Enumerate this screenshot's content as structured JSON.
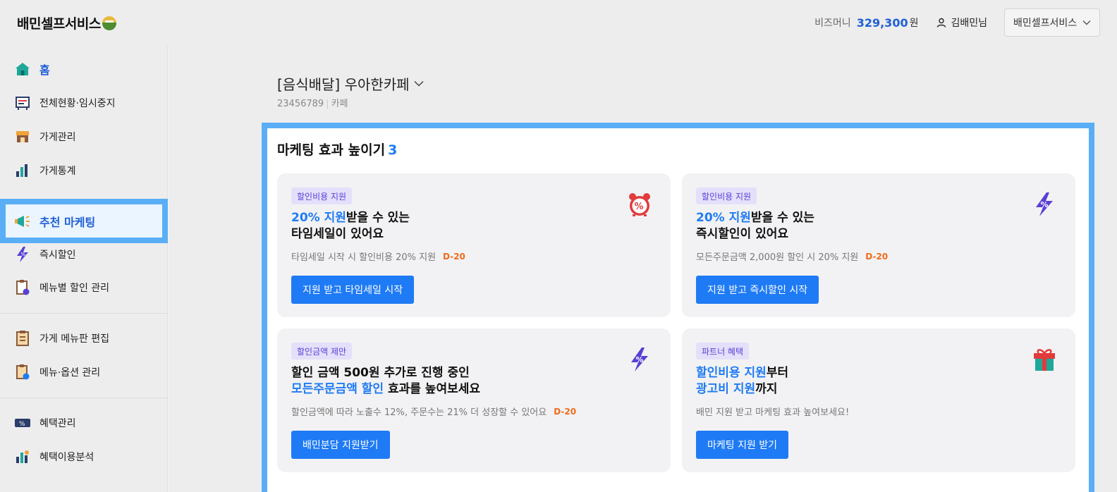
{
  "header": {
    "logo": "배민셀프서비스",
    "bizmoney_label": "비즈머니",
    "bizmoney_amount": "329,300",
    "bizmoney_unit": "원",
    "user_name": "김배민님",
    "store_select": "배민셀프서비스"
  },
  "sidebar": {
    "items": [
      {
        "label": "홈",
        "icon": "home-icon"
      },
      {
        "label": "전체현황·임시중지",
        "icon": "board-icon"
      },
      {
        "label": "가게관리",
        "icon": "store-icon"
      },
      {
        "label": "가게통계",
        "icon": "bar-chart-icon"
      },
      {
        "label": "추천 마케팅",
        "icon": "megaphone-icon"
      },
      {
        "label": "즉시할인",
        "icon": "lightning-percent-icon"
      },
      {
        "label": "메뉴별 할인 관리",
        "icon": "menu-discount-icon"
      },
      {
        "label": "가게 메뉴판 편집",
        "icon": "menu-board-icon"
      },
      {
        "label": "메뉴·옵션 관리",
        "icon": "menu-option-icon"
      },
      {
        "label": "혜택관리",
        "icon": "coupon-icon"
      },
      {
        "label": "혜택이용분석",
        "icon": "analysis-icon"
      }
    ]
  },
  "main": {
    "shop_title": "[음식배달] 우아한카페",
    "shop_id": "23456789",
    "shop_category": "카페",
    "panel_title": "마케팅 효과 높이기",
    "panel_count": "3",
    "cards": [
      {
        "badge": "할인비용 지원",
        "line1_highlight": "20% 지원",
        "line1_rest": "받을 수 있는",
        "line2_highlight": "",
        "line2_rest": "타임세일이 있어요",
        "desc": "타임세일 시작 시 할인비용 20% 지원",
        "dday": "D-20",
        "cta": "지원 받고 타임세일 시작",
        "icon": "alarm-clock-percent-icon"
      },
      {
        "badge": "할인비용 지원",
        "line1_highlight": "20% 지원",
        "line1_rest": "받을 수 있는",
        "line2_highlight": "",
        "line2_rest": "즉시할인이 있어요",
        "desc": "모든주문금액 2,000원 할인 시 20% 지원",
        "dday": "D-20",
        "cta": "지원 받고 즉시할인 시작",
        "icon": "lightning-percent-icon"
      },
      {
        "badge": "할인금액 제안",
        "line1_highlight": "",
        "line1_rest": "할인 금액 500원 추가로 진행 중인",
        "line2_highlight": "모든주문금액 할인",
        "line2_rest": " 효과를 높여보세요",
        "desc": "할인금액에 따라 노출수 12%, 주문수는 21% 더 성장할 수 있어요",
        "dday": "D-20",
        "cta": "배민분담 지원받기",
        "icon": "lightning-percent-icon"
      },
      {
        "badge": "파트너 혜택",
        "line1_highlight": "할인비용 지원",
        "line1_rest": "부터",
        "line2_highlight": "광고비 지원",
        "line2_rest": "까지",
        "desc": "배민 지원 받고 마케팅 효과 높여보세요!",
        "dday": "",
        "cta": "마케팅 지원 받기",
        "icon": "gift-icon"
      }
    ]
  },
  "colors": {
    "accent": "#1f7bf5",
    "highlight_border": "#5aaef5",
    "dday": "#f06a1a",
    "badge_bg": "#e4e0fb",
    "badge_text": "#5a3fd6"
  }
}
